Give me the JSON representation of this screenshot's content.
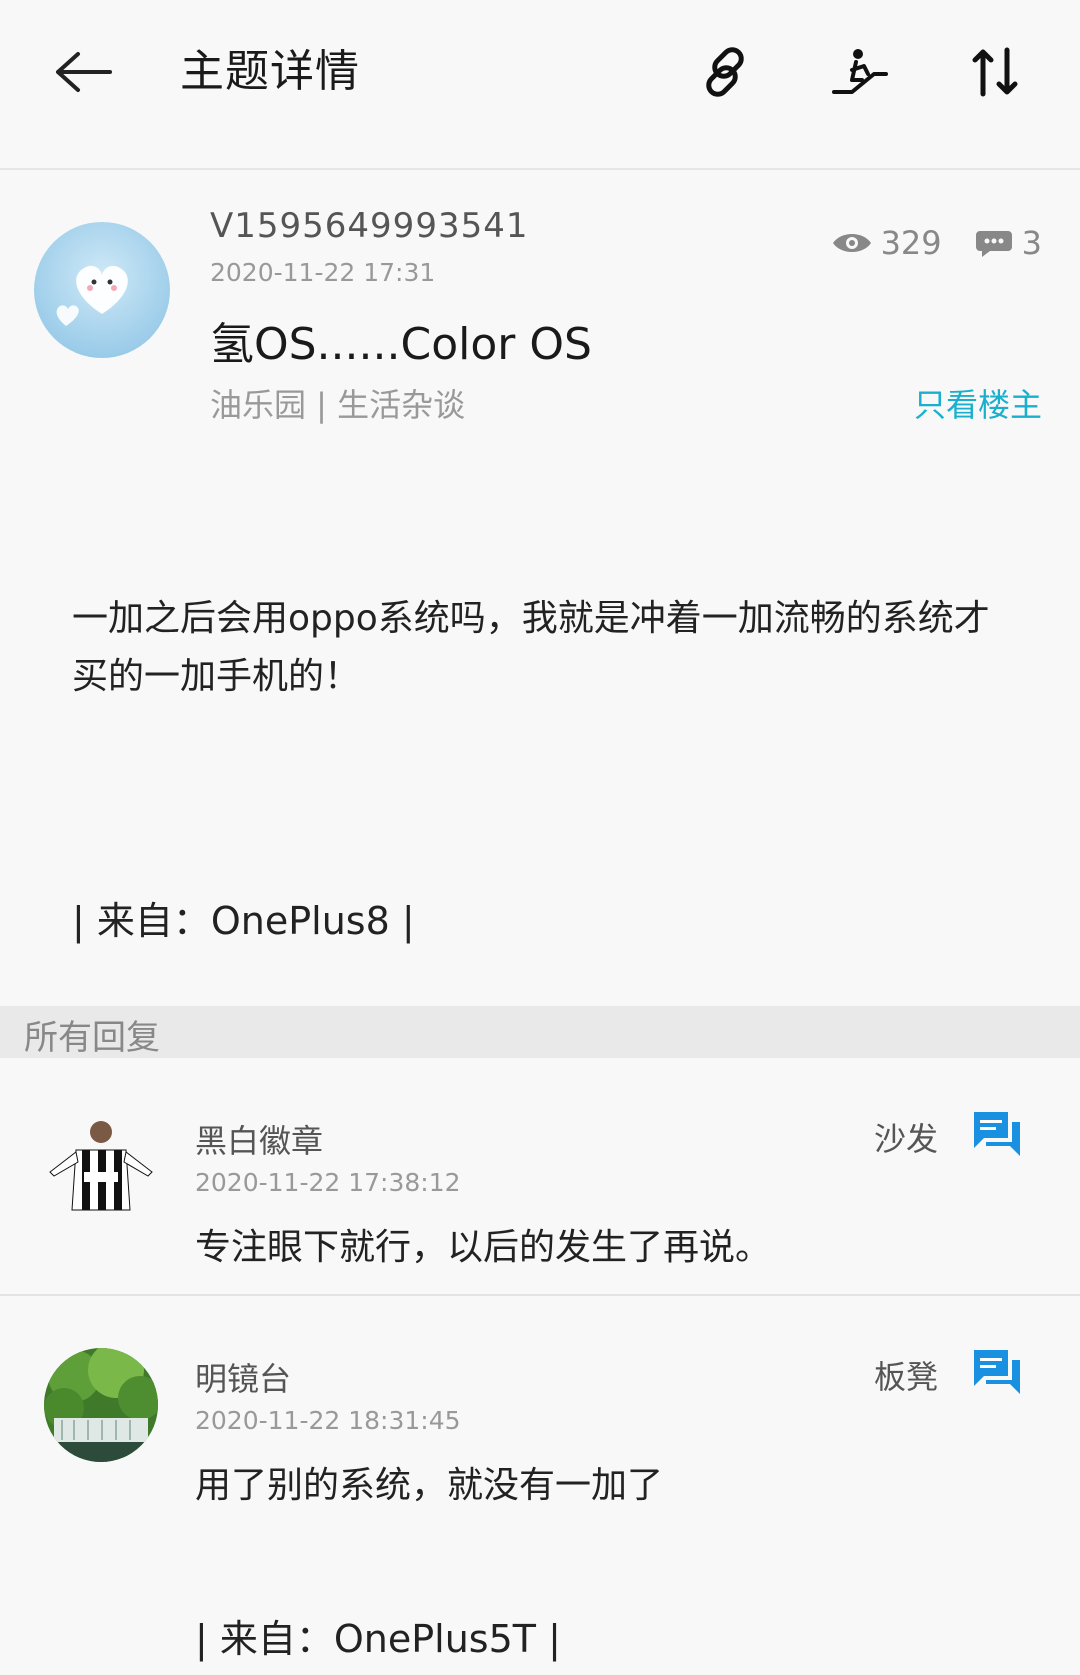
{
  "header": {
    "title": "主题详情",
    "icons": [
      "back-arrow-icon",
      "link-icon",
      "escalator-icon",
      "sort-icon"
    ]
  },
  "post": {
    "author": "V1595649993541",
    "time": "2020-11-22 17:31",
    "views": "329",
    "comments": "3",
    "title": "氢OS......Color OS",
    "meta": "油乐园 | 生活杂谈",
    "only_op_label": "只看楼主",
    "body": "一加之后会用oppo系统吗，我就是冲着一加流畅的系统才买的一加手机的！",
    "source": "| 来自：OnePlus8 |"
  },
  "replies_header": "所有回复",
  "replies": [
    {
      "name": "黑白徽章",
      "time": "2020-11-22 17:38:12",
      "floor": "沙发",
      "text": "专注眼下就行，以后的发生了再说。",
      "source": ""
    },
    {
      "name": "明镜台",
      "time": "2020-11-22 18:31:45",
      "floor": "板凳",
      "text": "用了别的系统，就没有一加了",
      "source": "| 来自：OnePlus5T |"
    }
  ],
  "colors": {
    "accent": "#1ab0cd",
    "reply_icon": "#1a90e0"
  }
}
